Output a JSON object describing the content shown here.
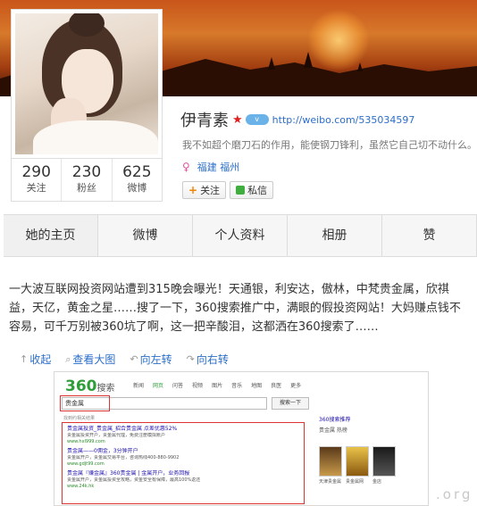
{
  "profile": {
    "name": "伊青素",
    "url": "http://weibo.com/535034597",
    "bio": "我不如超个磨刀石的作用，能使钢刀锋利，虽然它自己切不动什么。",
    "location": "福建 福州",
    "stats": [
      {
        "value": "290",
        "label": "关注"
      },
      {
        "value": "230",
        "label": "粉丝"
      },
      {
        "value": "625",
        "label": "微博"
      }
    ],
    "follow_label": "关注",
    "message_label": "私信"
  },
  "tabs": [
    "她的主页",
    "微博",
    "个人资料",
    "相册",
    "赞"
  ],
  "post": {
    "text": "一大波互联网投资网站遭到315晚会曝光！天通银，利安达，傲林，中梵贵金属，欣祺益，天亿，黄金之星……搜了一下，360搜索推广中，满眼的假投资网站！大妈赚点钱不容易，可千万别被360坑了啊，这一把辛酸泪，这都洒在360搜索了……"
  },
  "image_toolbar": [
    "收起",
    "查看大图",
    "向左转",
    "向右转"
  ],
  "embedded": {
    "logo": "360",
    "logo_suffix": "搜索",
    "navs": [
      "新闻",
      "网页",
      "问答",
      "视频",
      "图片",
      "音乐",
      "地图",
      "良医",
      "更多"
    ],
    "query": "贵金属",
    "search_button": "搜索一下",
    "meta": "找到约相关结果",
    "results": [
      {
        "title": "贵金属投资_贵金属_招合贵金属 点差优惠52%",
        "desc": "贵金属投资开户，贵金属代理，免费注册模拟账户",
        "url": "www.hxl999.com"
      },
      {
        "title": "贵金属——0佣金，3分钟开户",
        "desc": "贵金属开户，贵金属交易平台，咨询热线400-880-9902",
        "url": "www.gdjt99.com"
      },
      {
        "title": "贵金属『赚金属』360贵金属 | 金属开户，业务回报",
        "desc": "贵金属开户，贵金属投资全攻略，资金安全有保障，最高100%返还",
        "url": "www.24k.hk"
      }
    ],
    "side_title": "360搜索推荐",
    "side_sub": "贵金属 热榜",
    "thumb_captions": [
      "天津贵金属",
      "贵金属网",
      "金店"
    ]
  },
  "watermark": ".org"
}
